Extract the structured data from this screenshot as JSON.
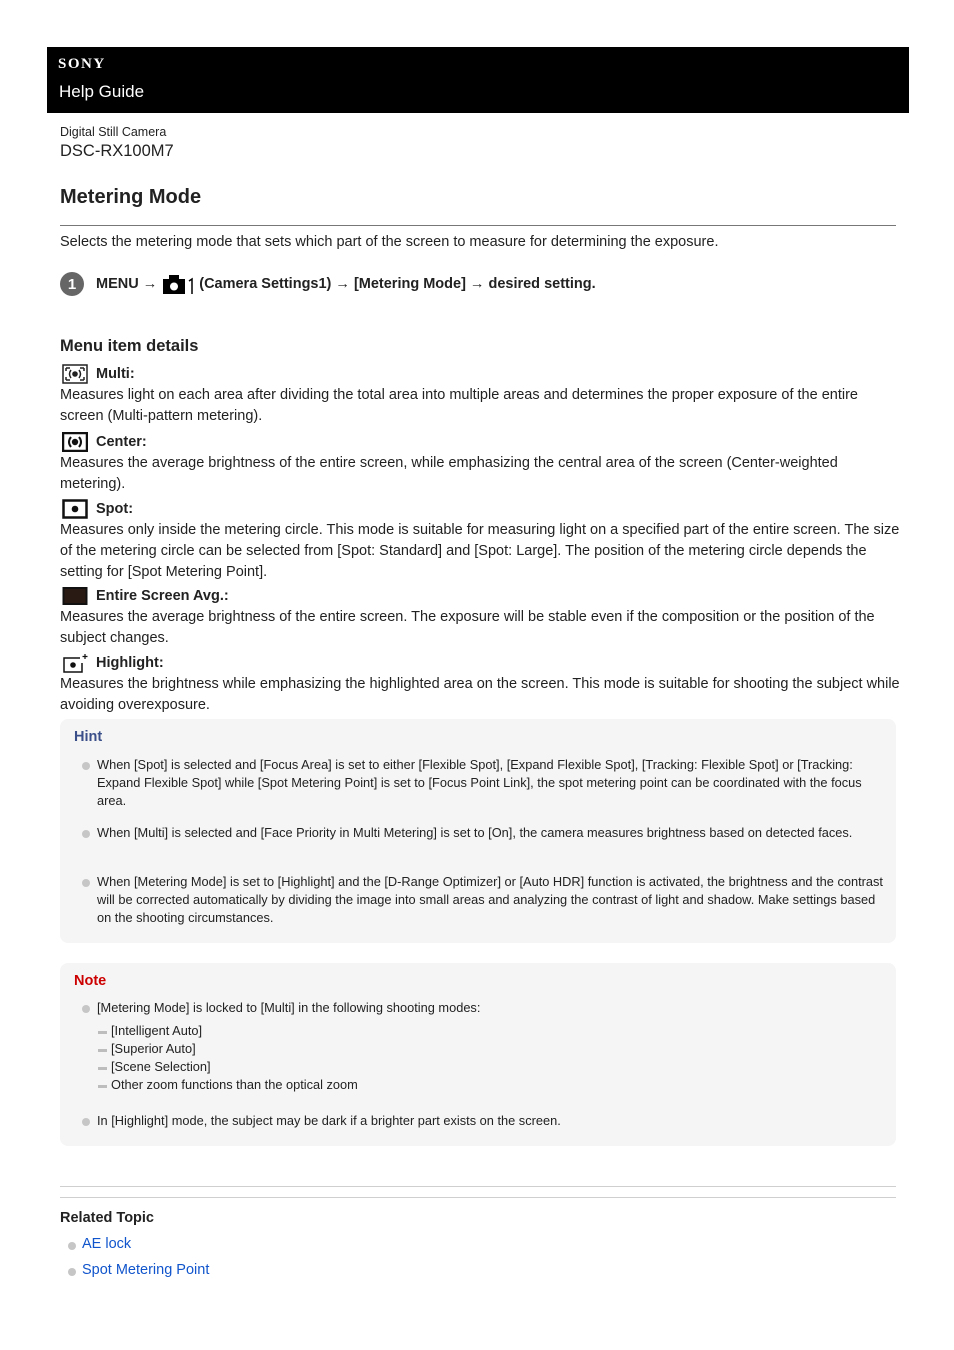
{
  "header": {
    "brand": "SONY",
    "title": "Help Guide"
  },
  "product": {
    "category": "Digital Still Camera",
    "model": "DSC-RX100M7"
  },
  "page": {
    "title": "Metering Mode",
    "intro": "Selects the metering mode that sets which part of the screen to measure for determining the exposure."
  },
  "step": {
    "number": "1",
    "menu": "MENU →",
    "camera_icon_suffix": "1",
    "path": "(Camera Settings1) → [Metering Mode] → desired setting."
  },
  "details": {
    "title": "Menu item details",
    "items": [
      {
        "icon": "multi-metering-icon",
        "label": "Multi:",
        "desc": "Measures light on each area after dividing the total area into multiple areas and determines the proper exposure of the entire screen (Multi-pattern metering)."
      },
      {
        "icon": "center-metering-icon",
        "label": "Center:",
        "desc": "Measures the average brightness of the entire screen, while emphasizing the central area of the screen (Center-weighted metering)."
      },
      {
        "icon": "spot-metering-icon",
        "label": "Spot:",
        "desc": "Measures only inside the metering circle. This mode is suitable for measuring light on a specified part of the entire screen. The size of the metering circle can be selected from [Spot: Standard] and [Spot: Large]. The position of the metering circle depends the setting for [Spot Metering Point]."
      },
      {
        "icon": "entire-screen-avg-icon",
        "label": "Entire Screen Avg.:",
        "desc": "Measures the average brightness of the entire screen. The exposure will be stable even if the composition or the position of the subject changes."
      },
      {
        "icon": "highlight-metering-icon",
        "label": "Highlight:",
        "desc": "Measures the brightness while emphasizing the highlighted area on the screen. This mode is suitable for shooting the subject while avoiding overexposure."
      }
    ]
  },
  "hint": {
    "title": "Hint",
    "color": "#3a4f8a",
    "items": [
      "When [Spot] is selected and [Focus Area] is set to either [Flexible Spot], [Expand Flexible Spot], [Tracking: Flexible Spot] or [Tracking: Expand Flexible Spot] while [Spot Metering Point] is set to [Focus Point Link], the spot metering point can be coordinated with the focus area.",
      "When [Multi] is selected and [Face Priority in Multi Metering] is set to [On], the camera measures brightness based on detected faces.",
      "When [Metering Mode] is set to [Highlight] and the [D-Range Optimizer] or [Auto HDR] function is activated, the brightness and the contrast will be corrected automatically by dividing the image into small areas and analyzing the contrast of light and shadow. Make settings based on the shooting circumstances."
    ]
  },
  "note": {
    "title": "Note",
    "color": "#cc0000",
    "items": [
      {
        "text": "[Metering Mode] is locked to [Multi] in the following shooting modes:",
        "sub": [
          "[Intelligent Auto]",
          "[Superior Auto]",
          "[Scene Selection]",
          "Other zoom functions than the optical zoom"
        ]
      },
      {
        "text": "In [Highlight] mode, the subject may be dark if a brighter part exists on the screen."
      }
    ]
  },
  "related": {
    "title": "Related Topic",
    "links": [
      "AE lock",
      "Spot Metering Point"
    ],
    "link_color": "#1155cc"
  }
}
